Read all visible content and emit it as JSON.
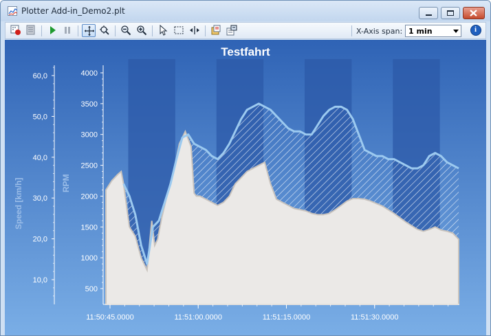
{
  "window": {
    "title": "Plotter Add-in_Demo2.plt"
  },
  "toolbar": {
    "buttons": [
      "record-icon",
      "clear-icon",
      "play-icon",
      "pause-icon",
      "pan-icon",
      "zoom-area-icon",
      "zoom-out-icon",
      "zoom-in-icon",
      "select-icon",
      "rect-select-icon",
      "fit-width-icon",
      "open-icon",
      "properties-icon"
    ],
    "xspan_label": "X-Axis span:",
    "xspan_value": "1 min",
    "info_icon": "info-icon"
  },
  "colors": {
    "plot_top": "#2f63b5",
    "plot_bottom": "#7aaee6",
    "band": "#2c5aa8",
    "fill_area": "#ebe9e7",
    "line_light": "#9ccaf0",
    "axis_title": "#9bbde8"
  },
  "chart_data": {
    "type": "area",
    "title": "Testfahrt",
    "y_left_label": "Speed [km/h]",
    "y_left_ticks": [
      "10,0",
      "20,0",
      "30,0",
      "40,0",
      "50,0",
      "60,0"
    ],
    "y_left_range": [
      0,
      65
    ],
    "y_right_label": "RPM",
    "y_right_ticks": [
      "500",
      "1000",
      "1500",
      "2000",
      "2500",
      "3000",
      "3500",
      "4000"
    ],
    "y_right_range": [
      100,
      4200
    ],
    "x_ticks": [
      "11:50:45.0000",
      "11:51:00.0000",
      "11:51:15.0000",
      "11:51:30.0000"
    ],
    "x_range_s": [
      0,
      60
    ],
    "x_tick_s": [
      0.7,
      15.7,
      30.7,
      45.7
    ],
    "series": [
      {
        "name": "RPM",
        "kind": "area",
        "x": [
          0,
          1,
          2,
          2.6,
          3,
          4,
          5,
          6,
          7,
          7.8,
          8.3,
          8.8,
          9.5,
          10.5,
          11.5,
          12.5,
          13.5,
          14.5,
          15,
          15.4,
          16,
          17,
          18,
          19,
          20,
          21,
          22,
          23,
          24,
          25,
          26,
          27,
          28,
          29,
          30,
          31,
          32,
          33,
          34,
          35,
          36,
          37,
          38,
          39,
          40,
          41,
          42,
          43,
          44,
          45,
          46,
          47,
          48,
          49,
          50,
          51,
          52,
          53,
          54,
          55,
          56,
          57,
          58,
          59,
          60
        ],
        "y": [
          2100,
          2250,
          2350,
          2400,
          2200,
          1500,
          1350,
          1000,
          800,
          1600,
          1200,
          1300,
          1650,
          2050,
          2400,
          2850,
          3050,
          2800,
          2050,
          2000,
          2000,
          1950,
          1900,
          1850,
          1900,
          2000,
          2200,
          2300,
          2400,
          2450,
          2500,
          2550,
          2200,
          1950,
          1900,
          1850,
          1800,
          1780,
          1760,
          1720,
          1700,
          1700,
          1720,
          1780,
          1850,
          1920,
          1960,
          1960,
          1950,
          1920,
          1880,
          1840,
          1780,
          1720,
          1650,
          1580,
          1520,
          1460,
          1430,
          1460,
          1500,
          1450,
          1430,
          1400,
          1300
        ]
      },
      {
        "name": "Speed [km/h]",
        "kind": "line",
        "x": [
          3,
          4,
          5,
          6,
          7,
          8,
          9,
          10,
          11,
          12,
          13,
          14,
          15,
          16,
          17,
          18,
          19,
          20,
          21,
          22,
          23,
          24,
          25,
          26,
          27,
          28,
          29,
          30,
          31,
          32,
          33,
          34,
          35,
          36,
          37,
          38,
          39,
          40,
          41,
          42,
          43,
          44,
          45,
          46,
          47,
          48,
          49,
          50,
          51,
          52,
          53,
          54,
          55,
          56,
          57,
          58,
          59,
          60
        ],
        "y": [
          2200,
          2000,
          1700,
          1200,
          900,
          1500,
          1600,
          1900,
          2200,
          2600,
          2950,
          3000,
          2850,
          2800,
          2750,
          2650,
          2600,
          2700,
          2850,
          3050,
          3250,
          3400,
          3450,
          3500,
          3450,
          3400,
          3300,
          3200,
          3100,
          3050,
          3050,
          3000,
          3000,
          3150,
          3300,
          3400,
          3450,
          3450,
          3400,
          3250,
          3000,
          2750,
          2700,
          2650,
          2650,
          2600,
          2600,
          2550,
          2500,
          2450,
          2450,
          2500,
          2650,
          2700,
          2650,
          2550,
          2500,
          2450
        ]
      }
    ]
  }
}
